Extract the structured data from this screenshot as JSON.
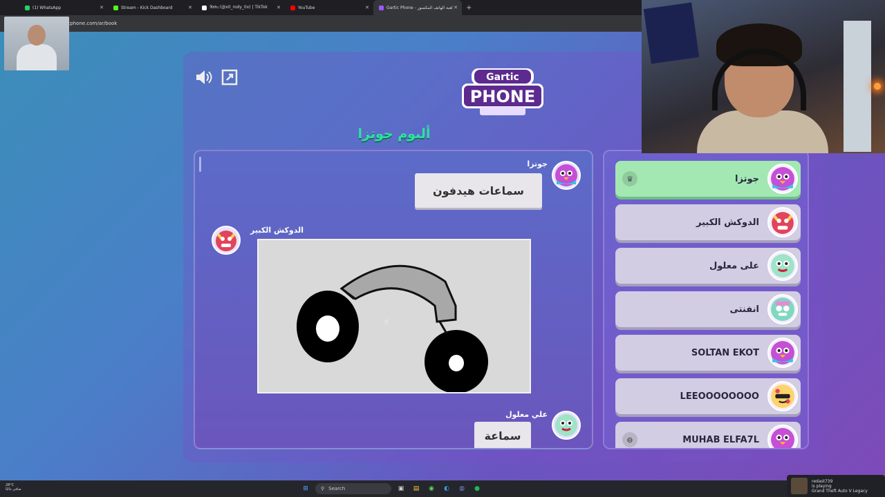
{
  "browser": {
    "tabs": [
      {
        "label": "(1) WhatsApp",
        "color": "#25d366"
      },
      {
        "label": "Stream - Kick Dashboard",
        "color": "#53fc18"
      },
      {
        "label": "ℜ𝔬𝔡𝔶 (@x0_rody_0x) | TikTok",
        "color": "#ffffff"
      },
      {
        "label": "YouTube",
        "color": "#ff0000"
      },
      {
        "label": "Gartic Phone - لعبة الهاتف المكسور",
        "color": "#9b59ff"
      }
    ],
    "url": "garticphone.com/ar/book"
  },
  "game": {
    "logo_line1": "Gartic",
    "logo_line2": "PHONE",
    "album_title": "ألبوم جوتزا",
    "entries": [
      {
        "author": "جوتزا",
        "text": "سماعات هيدفون"
      },
      {
        "author": "الدوكش الكبير"
      },
      {
        "author": "علي معلول",
        "text": "سماعة"
      }
    ],
    "players": [
      {
        "name": "جوتزا",
        "host": true
      },
      {
        "name": "الدوكش الكبير"
      },
      {
        "name": "على معلول"
      },
      {
        "name": "انفنتى"
      },
      {
        "name": "SOLTAN EKOT"
      },
      {
        "name": "LEEOOOOOOOO"
      },
      {
        "name": "MUHAB ELFA7L"
      }
    ]
  },
  "taskbar": {
    "weather_temp": "28°C",
    "weather_desc": "صافي غالبًا",
    "search_label": "Search"
  },
  "now_playing": {
    "user": "redast739",
    "status": "is playing",
    "game": "Grand Theft Auto V Legacy"
  }
}
